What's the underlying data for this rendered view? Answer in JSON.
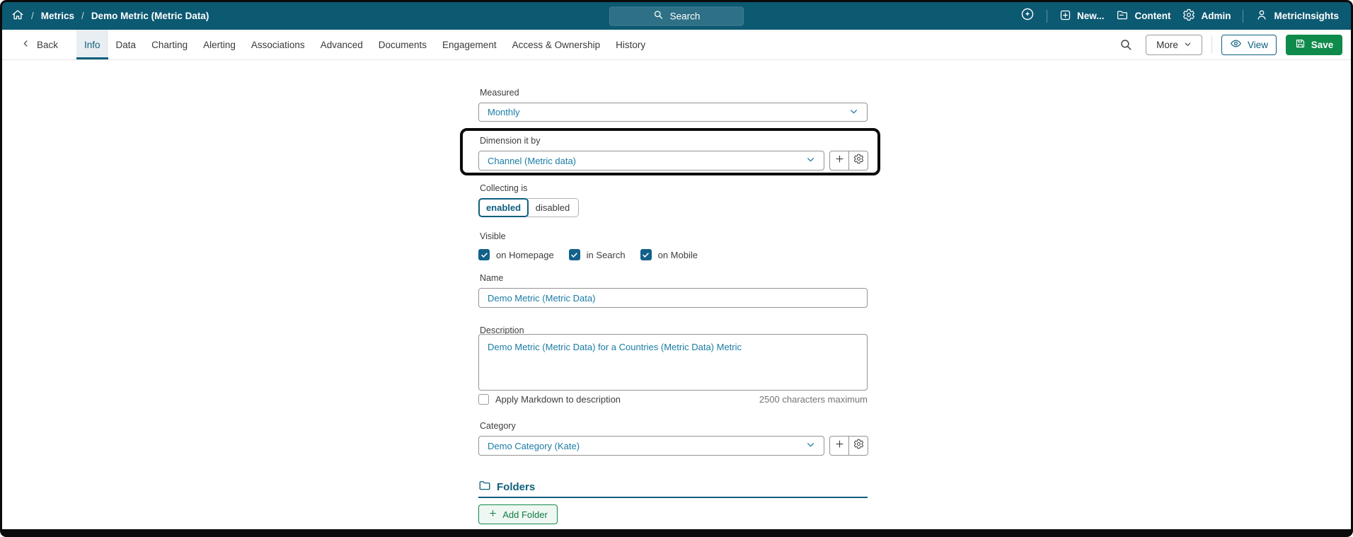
{
  "colors": {
    "navbar_teal": "#0c5972",
    "accent_teal": "#0e5f7d",
    "value_link_blue": "#1a7ca6",
    "save_green": "#0e8a4a",
    "checkbox_teal": "#13618b",
    "annotation_black": "#0b0b0b",
    "active_tab_bg": "#e8eef2"
  },
  "icons": {
    "home-icon": "house outline",
    "search-icon": "magnifier",
    "assistant-icon": "sparkle in circle",
    "plus-square-icon": "plus in rounded square",
    "content-icon": "folder with line",
    "gear-icon": "cogwheel outline",
    "user-icon": "person outline",
    "chevron-left-icon": "‹",
    "chevron-down-icon": "⌄",
    "eye-icon": "eye outline",
    "save-icon": "floppy disk outline",
    "plus-icon": "+",
    "folder-icon": "folder outline",
    "check-icon": "✓"
  },
  "navbar": {
    "breadcrumb": {
      "separator": "/",
      "items": [
        "Metrics",
        "Demo Metric (Metric Data)"
      ]
    },
    "search": {
      "placeholder": "Search"
    },
    "actions": {
      "new_label": "New...",
      "content_label": "Content",
      "admin_label": "Admin",
      "account_label": "MetricInsights"
    }
  },
  "tabbar": {
    "back_label": "Back",
    "tabs": [
      {
        "label": "Info",
        "active": true
      },
      {
        "label": "Data",
        "active": false
      },
      {
        "label": "Charting",
        "active": false
      },
      {
        "label": "Alerting",
        "active": false
      },
      {
        "label": "Associations",
        "active": false
      },
      {
        "label": "Advanced",
        "active": false
      },
      {
        "label": "Documents",
        "active": false
      },
      {
        "label": "Engagement",
        "active": false
      },
      {
        "label": "Access & Ownership",
        "active": false
      },
      {
        "label": "History",
        "active": false
      }
    ],
    "more_label": "More",
    "view_label": "View",
    "save_label": "Save"
  },
  "form": {
    "measured": {
      "label": "Measured",
      "value": "Monthly"
    },
    "dimension": {
      "label": "Dimension it by",
      "value": "Channel (Metric data)",
      "highlighted": true
    },
    "collecting": {
      "label": "Collecting is",
      "enabled_label": "enabled",
      "disabled_label": "disabled",
      "selected": "enabled"
    },
    "visible": {
      "label": "Visible",
      "options": [
        {
          "label": "on Homepage",
          "checked": true
        },
        {
          "label": "in Search",
          "checked": true
        },
        {
          "label": "on Mobile",
          "checked": true
        }
      ]
    },
    "name": {
      "label": "Name",
      "value": "Demo Metric (Metric Data)"
    },
    "description": {
      "label": "Description",
      "value": "Demo Metric (Metric Data) for a Countries (Metric Data) Metric",
      "markdown_label": "Apply Markdown to description",
      "markdown_checked": false,
      "max_hint": "2500 characters maximum"
    },
    "category": {
      "label": "Category",
      "value": "Demo Category (Kate)"
    },
    "folders": {
      "title": "Folders",
      "add_button_label": "Add Folder"
    }
  }
}
